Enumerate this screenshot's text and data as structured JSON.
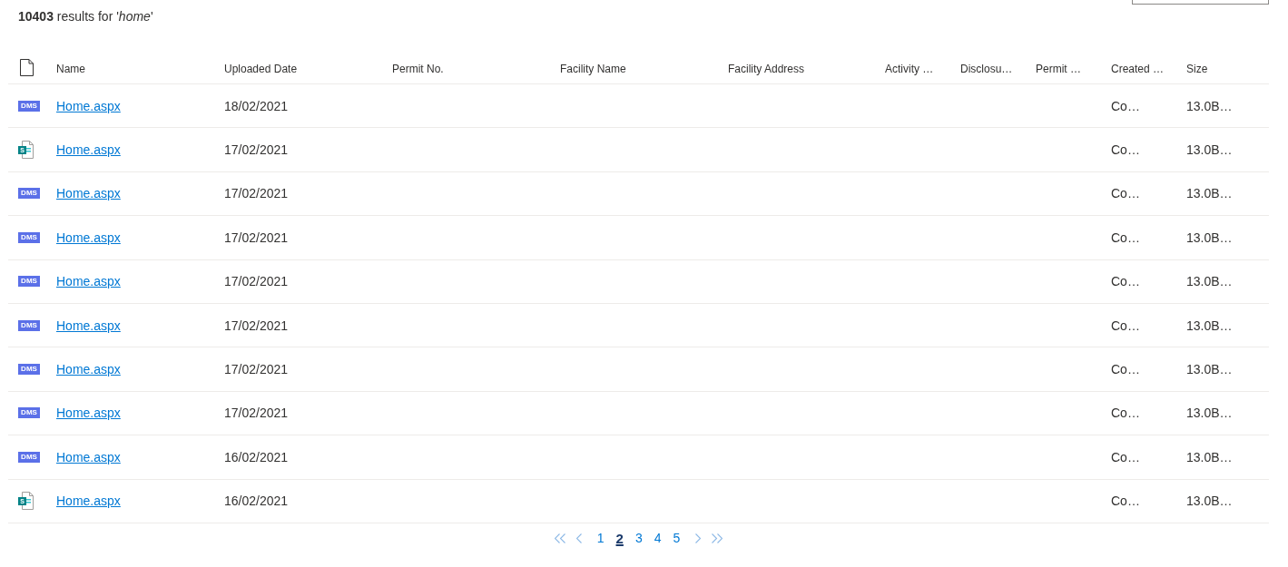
{
  "title": "**10403** results for '*home*'",
  "table": {
    "columns": [
      "Name",
      "Uploaded Date",
      "Permit No.",
      "Facility Name",
      "Facility Address",
      "Activity …",
      "Disclosu…",
      "Permit …",
      "Created …",
      "Size"
    ],
    "rows": [
      {
        "icon": {
          "kind": "dms",
          "text": "DMS"
        },
        "name": "Home.aspx",
        "uploaded_date": "18/02/2021",
        "created": "Co…",
        "size": "13.0B…"
      },
      {
        "icon": {
          "kind": "page",
          "text": "S"
        },
        "name": "Home.aspx",
        "uploaded_date": "17/02/2021",
        "created": "Co…",
        "size": "13.0B…"
      },
      {
        "icon": {
          "kind": "dms",
          "text": "DMS"
        },
        "name": "Home.aspx",
        "uploaded_date": "17/02/2021",
        "created": "Co…",
        "size": "13.0B…"
      },
      {
        "icon": {
          "kind": "dms",
          "text": "DMS"
        },
        "name": "Home.aspx",
        "uploaded_date": "17/02/2021",
        "created": "Co…",
        "size": "13.0B…"
      },
      {
        "icon": {
          "kind": "dms",
          "text": "DMS"
        },
        "name": "Home.aspx",
        "uploaded_date": "17/02/2021",
        "created": "Co…",
        "size": "13.0B…"
      },
      {
        "icon": {
          "kind": "dms",
          "text": "DMS"
        },
        "name": "Home.aspx",
        "uploaded_date": "17/02/2021",
        "created": "Co…",
        "size": "13.0B…"
      },
      {
        "icon": {
          "kind": "dms",
          "text": "DMS"
        },
        "name": "Home.aspx",
        "uploaded_date": "17/02/2021",
        "created": "Co…",
        "size": "13.0B…"
      },
      {
        "icon": {
          "kind": "dms",
          "text": "DMS"
        },
        "name": "Home.aspx",
        "uploaded_date": "17/02/2021",
        "created": "Co…",
        "size": "13.0B…"
      },
      {
        "icon": {
          "kind": "dms",
          "text": "DMS"
        },
        "name": "Home.aspx",
        "uploaded_date": "16/02/2021",
        "created": "Co…",
        "size": "13.0B…"
      },
      {
        "icon": {
          "kind": "page",
          "text": "S"
        },
        "name": "Home.aspx",
        "uploaded_date": "16/02/2021",
        "created": "Co…",
        "size": "13.0B…"
      }
    ]
  },
  "pagination": {
    "pages": [
      {
        "label": "1",
        "selected": false
      },
      {
        "label": "2",
        "selected": true
      },
      {
        "label": "3",
        "selected": false
      },
      {
        "label": "4",
        "selected": false
      },
      {
        "label": "5",
        "selected": false
      }
    ]
  }
}
